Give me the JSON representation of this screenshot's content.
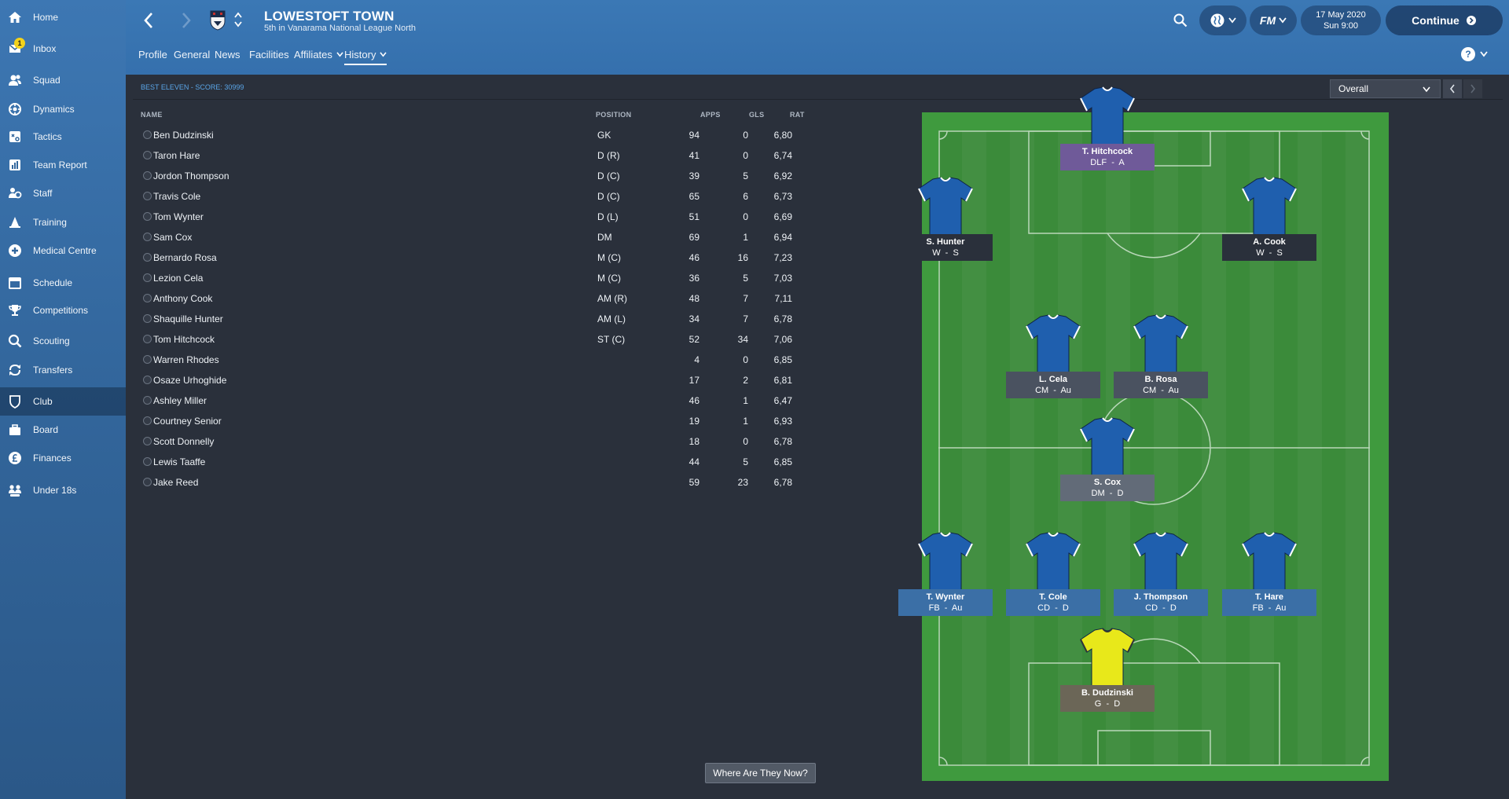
{
  "sidebar": {
    "items": [
      {
        "label": "Home",
        "icon": "home-icon"
      },
      {
        "label": "Inbox",
        "icon": "inbox-icon",
        "badge": "1"
      },
      {
        "label": "Squad",
        "icon": "squad-icon"
      },
      {
        "label": "Dynamics",
        "icon": "dynamics-icon"
      },
      {
        "label": "Tactics",
        "icon": "tactics-icon"
      },
      {
        "label": "Team Report",
        "icon": "team-report-icon"
      },
      {
        "label": "Staff",
        "icon": "staff-icon"
      },
      {
        "label": "Training",
        "icon": "training-icon"
      },
      {
        "label": "Medical Centre",
        "icon": "medical-icon"
      },
      {
        "label": "Schedule",
        "icon": "schedule-icon"
      },
      {
        "label": "Competitions",
        "icon": "trophy-icon"
      },
      {
        "label": "Scouting",
        "icon": "scouting-icon"
      },
      {
        "label": "Transfers",
        "icon": "transfers-icon"
      },
      {
        "label": "Club",
        "icon": "club-icon"
      },
      {
        "label": "Board",
        "icon": "board-icon"
      },
      {
        "label": "Finances",
        "icon": "finances-icon"
      },
      {
        "label": "Under 18s",
        "icon": "under18s-icon"
      }
    ]
  },
  "header": {
    "club_name": "LOWESTOFT TOWN",
    "club_subtitle": "5th in Vanarama National League North",
    "date": "17 May 2020",
    "time": "Sun 9:00",
    "continue_label": "Continue",
    "fm_label": "FM",
    "help_label": "?"
  },
  "tabs": [
    {
      "label": "Profile"
    },
    {
      "label": "General"
    },
    {
      "label": "News"
    },
    {
      "label": "Facilities"
    },
    {
      "label": "Affiliates"
    },
    {
      "label": "History"
    }
  ],
  "panel": {
    "title": "BEST ELEVEN - SCORE: 30999",
    "filter": "Overall",
    "where_button": "Where Are They Now?"
  },
  "table": {
    "headers": {
      "name": "NAME",
      "position": "POSITION",
      "apps": "APPS",
      "gls": "GLS",
      "rat": "RAT"
    },
    "rows": [
      {
        "name": "Ben Dudzinski",
        "position": "GK",
        "apps": "94",
        "gls": "0",
        "rat": "6,80"
      },
      {
        "name": "Taron Hare",
        "position": "D (R)",
        "apps": "41",
        "gls": "0",
        "rat": "6,74"
      },
      {
        "name": "Jordon Thompson",
        "position": "D (C)",
        "apps": "39",
        "gls": "5",
        "rat": "6,92"
      },
      {
        "name": "Travis Cole",
        "position": "D (C)",
        "apps": "65",
        "gls": "6",
        "rat": "6,73"
      },
      {
        "name": "Tom Wynter",
        "position": "D (L)",
        "apps": "51",
        "gls": "0",
        "rat": "6,69"
      },
      {
        "name": "Sam Cox",
        "position": "DM",
        "apps": "69",
        "gls": "1",
        "rat": "6,94"
      },
      {
        "name": "Bernardo Rosa",
        "position": "M (C)",
        "apps": "46",
        "gls": "16",
        "rat": "7,23"
      },
      {
        "name": "Lezion Cela",
        "position": "M (C)",
        "apps": "36",
        "gls": "5",
        "rat": "7,03"
      },
      {
        "name": "Anthony Cook",
        "position": "AM (R)",
        "apps": "48",
        "gls": "7",
        "rat": "7,11"
      },
      {
        "name": "Shaquille Hunter",
        "position": "AM (L)",
        "apps": "34",
        "gls": "7",
        "rat": "6,78"
      },
      {
        "name": "Tom Hitchcock",
        "position": "ST (C)",
        "apps": "52",
        "gls": "34",
        "rat": "7,06"
      },
      {
        "name": "Warren Rhodes",
        "position": "",
        "apps": "4",
        "gls": "0",
        "rat": "6,85"
      },
      {
        "name": "Osaze Urhoghide",
        "position": "",
        "apps": "17",
        "gls": "2",
        "rat": "6,81"
      },
      {
        "name": "Ashley Miller",
        "position": "",
        "apps": "46",
        "gls": "1",
        "rat": "6,47"
      },
      {
        "name": "Courtney Senior",
        "position": "",
        "apps": "19",
        "gls": "1",
        "rat": "6,93"
      },
      {
        "name": "Scott Donnelly",
        "position": "",
        "apps": "18",
        "gls": "0",
        "rat": "6,78"
      },
      {
        "name": "Lewis Taaffe",
        "position": "",
        "apps": "44",
        "gls": "5",
        "rat": "6,85"
      },
      {
        "name": "Jake Reed",
        "position": "",
        "apps": "59",
        "gls": "23",
        "rat": "6,78"
      }
    ]
  },
  "pitch": {
    "players": [
      {
        "name": "T. Hitchcock",
        "role": "DLF  -  A",
        "label_color": "#6f5a99",
        "shirt": "blue"
      },
      {
        "name": "S. Hunter",
        "role": "W  -  S",
        "label_color": "#2a303b",
        "shirt": "blue"
      },
      {
        "name": "A. Cook",
        "role": "W  -  S",
        "label_color": "#2a303b",
        "shirt": "blue"
      },
      {
        "name": "L. Cela",
        "role": "CM  -  Au",
        "label_color": "#4a5260",
        "shirt": "blue"
      },
      {
        "name": "B. Rosa",
        "role": "CM  -  Au",
        "label_color": "#4a5260",
        "shirt": "blue"
      },
      {
        "name": "S. Cox",
        "role": "DM  -  D",
        "label_color": "#626b78",
        "shirt": "blue"
      },
      {
        "name": "T. Wynter",
        "role": "FB  -  Au",
        "label_color": "#3b6fa6",
        "shirt": "blue"
      },
      {
        "name": "T. Cole",
        "role": "CD  -  D",
        "label_color": "#3b6fa6",
        "shirt": "blue"
      },
      {
        "name": "J. Thompson",
        "role": "CD  -  D",
        "label_color": "#3b6fa6",
        "shirt": "blue"
      },
      {
        "name": "T. Hare",
        "role": "FB  -  Au",
        "label_color": "#3b6fa6",
        "shirt": "blue"
      },
      {
        "name": "B. Dudzinski",
        "role": "G  -  D",
        "label_color": "#6b6657",
        "shirt": "yellow"
      }
    ]
  },
  "colors": {
    "accent": "#5aa6e8",
    "sidebar": "#33679d",
    "pitch_green": "#3f9a3e",
    "shirt_blue": "#1f5fae",
    "gk_yellow": "#e8e81a"
  }
}
